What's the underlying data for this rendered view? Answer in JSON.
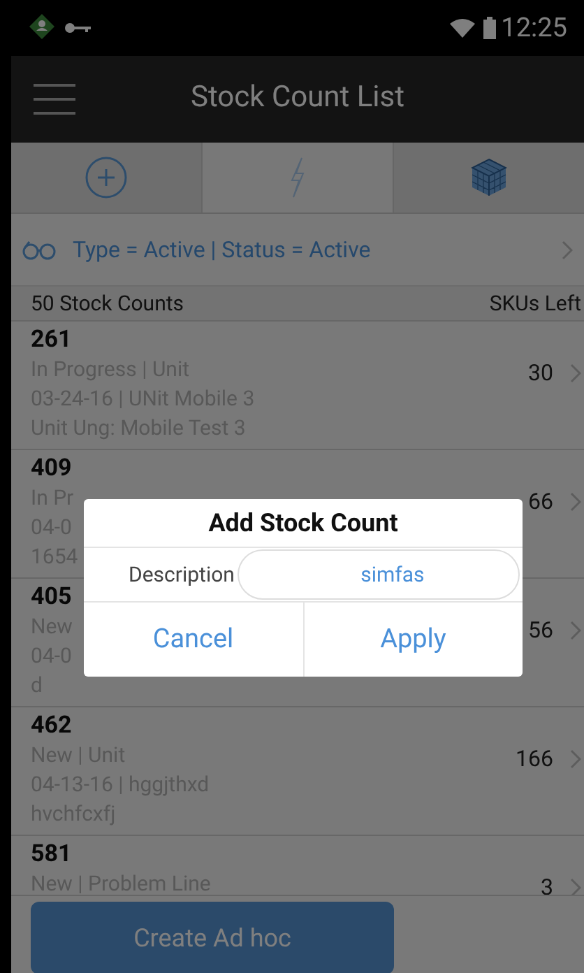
{
  "status_bar": {
    "time": "12:25"
  },
  "app_bar": {
    "title": "Stock Count List"
  },
  "filter": {
    "text": "Type = Active | Status = Active"
  },
  "list_header": {
    "count": "50 Stock Counts",
    "skus": "SKUs Left"
  },
  "rows": [
    {
      "number": "261",
      "lines": [
        "In Progress | Unit",
        "03-24-16 | UNit Mobile 3",
        "Unit Ung: Mobile Test 3"
      ],
      "skus": "30"
    },
    {
      "number": "409",
      "lines": [
        "In Pr",
        "04-0",
        "1654"
      ],
      "skus": "66"
    },
    {
      "number": "405",
      "lines": [
        "New",
        "04-0",
        "d"
      ],
      "skus": "56"
    },
    {
      "number": "462",
      "lines": [
        "New | Unit",
        "04-13-16 | hggjthxd",
        "hvchfcxfj"
      ],
      "skus": "166"
    },
    {
      "number": "581",
      "lines": [
        "New | Problem Line"
      ],
      "skus": "3"
    }
  ],
  "bottom_button": {
    "label": "Create Ad hoc"
  },
  "dialog": {
    "title": "Add Stock Count",
    "field_label": "Description",
    "field_value": "simfas",
    "buttons": [
      "Cancel",
      "Apply"
    ]
  }
}
